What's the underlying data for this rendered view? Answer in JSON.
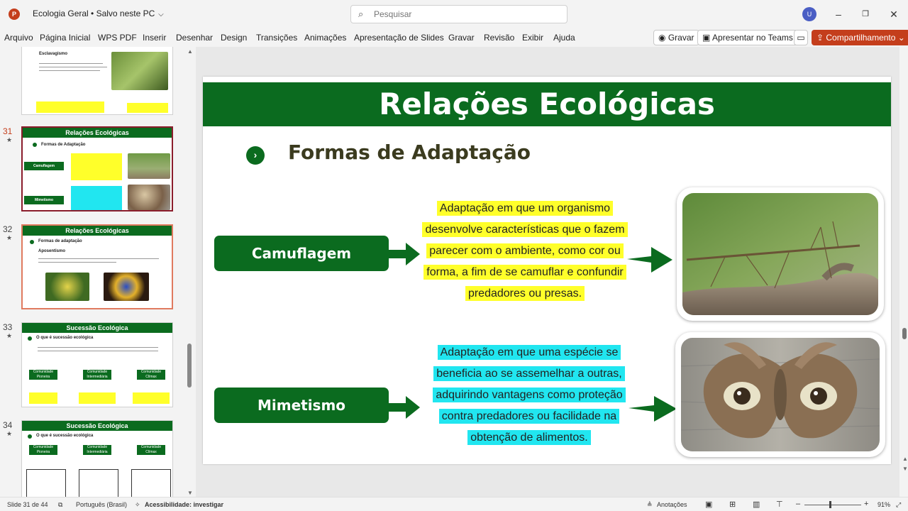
{
  "app": {
    "logo_letter": "P",
    "doc_title": "Ecologia Geral • Salvo neste PC",
    "search_placeholder": "Pesquisar",
    "avatar_initial": "U"
  },
  "ribbon": {
    "tabs": [
      "Arquivo",
      "Página Inicial",
      "WPS PDF",
      "Inserir",
      "Desenhar",
      "Design",
      "Transições",
      "Animações",
      "Apresentação de Slides",
      "Gravar",
      "Revisão",
      "Exibir",
      "Ajuda"
    ],
    "record_label": "Gravar",
    "teams_label": "Apresentar no Teams",
    "share_label": "Compartilhamento"
  },
  "thumbnails": [
    {
      "num": "31",
      "title": "Relações Ecológicas",
      "sub": "Formas de Adaptação",
      "box1": "Camuflagem",
      "box2": "Mimetismo"
    },
    {
      "num": "32",
      "title": "Relações Ecológicas",
      "sub": "Formas de adaptação",
      "sub2": "Aposentismo"
    },
    {
      "num": "33",
      "title": "Sucessão Ecológica",
      "sub": "O que é sucessão ecológica",
      "box1": "Comunidade Pioneira",
      "box2": "Comunidade Intermediária",
      "box3": "Comunidade Clímax"
    },
    {
      "num": "34",
      "title": "Sucessão Ecológica",
      "sub": "O que é sucessão ecológica",
      "box1": "Comunidade Pioneira",
      "box2": "Comunidade Intermediária",
      "box3": "Comunidade Clímax"
    }
  ],
  "thumb_prev": {
    "sub": "Esclavagismo"
  },
  "slide": {
    "title": "Relações Ecológicas",
    "section": "Formas de Adaptação",
    "bullet": "›",
    "items": [
      {
        "label": "Camuflagem",
        "description": "Adaptação em que um organismo desenvolve características que o fazem parecer com o ambiente, como cor ou forma, a fim de se camuflar e confundir predadores ou presas.",
        "highlight": "#ffff2a",
        "photo": "stick-insect"
      },
      {
        "label": "Mimetismo",
        "description": "Adaptação em que uma espécie se beneficia ao se assemelhar a outras, adquirindo vantagens como proteção contra predadores ou facilidade na obtenção de alimentos.",
        "highlight": "#21e6f0",
        "photo": "owl-eyed-moth"
      }
    ]
  },
  "status": {
    "slide_counter": "Slide 31 de 44",
    "language": "Português (Brasil)",
    "accessibility": "Acessibilidade: investigar",
    "notes": "Anotações",
    "zoom": "91%"
  },
  "colors": {
    "accent_green": "#0b6b1f",
    "share_red": "#c43e1c",
    "selected_thumb": "#8b1d2c"
  }
}
